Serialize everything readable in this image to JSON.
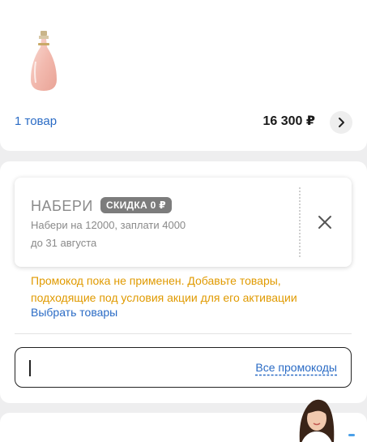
{
  "cart": {
    "count_label": "1 товар",
    "total": "16 300 ₽",
    "product_image": "perfume-bottle"
  },
  "coupon": {
    "name": "НАБЕРИ",
    "badge": "СКИДКА 0 ₽",
    "condition": "Набери на 12000, заплати 4000",
    "valid_until": "до 31 августа"
  },
  "promo": {
    "warning": "Промокод пока не применен. Добавьте товары, подходящие под условия акции для его активации",
    "select_link": "Выбрать товары",
    "input_value": "",
    "input_placeholder": "",
    "all_promos_link": "Все промокоды"
  },
  "colors": {
    "link": "#2a6bc5",
    "warning": "#e09a00",
    "badge_bg": "#7c7c7c"
  },
  "icons": {
    "next": "chevron-right-icon",
    "remove": "close-icon",
    "assistant": "assistant-avatar"
  }
}
